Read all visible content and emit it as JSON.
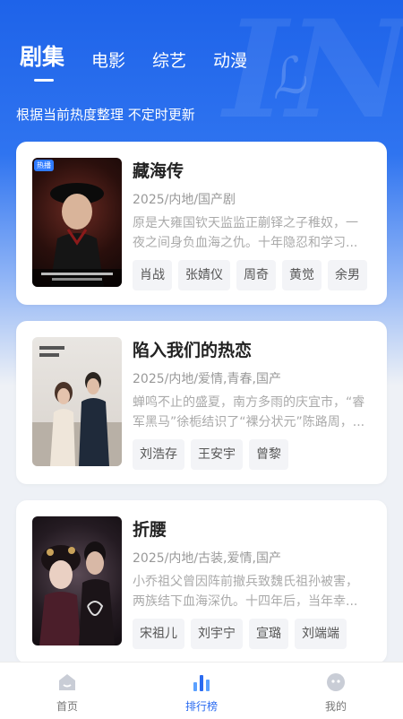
{
  "header": {
    "tabs": [
      {
        "label": "剧集",
        "active": true
      },
      {
        "label": "电影",
        "active": false
      },
      {
        "label": "综艺",
        "active": false
      },
      {
        "label": "动漫",
        "active": false
      }
    ],
    "subtitle": "根据当前热度整理 不定时更新"
  },
  "list": [
    {
      "title": "藏海传",
      "meta": "2025/内地/国产剧",
      "desc": "原是大雍国钦天监监正蒯铎之子稚奴，一夜之间身负血海之仇。十年隐忍和学习...",
      "tags": [
        "肖战",
        "张婧仪",
        "周奇",
        "黄觉",
        "余男"
      ],
      "badge": "热播"
    },
    {
      "title": "陷入我们的热恋",
      "meta": "2025/内地/爱情,青春,国产",
      "desc": "蝉鸣不止的盛夏，南方多雨的庆宜市，“睿军黑马”徐栀结识了“裸分状元”陈路周，...",
      "tags": [
        "刘浩存",
        "王安宇",
        "曾黎"
      ]
    },
    {
      "title": "折腰",
      "meta": "2025/内地/古装,爱情,国产",
      "desc": "小乔祖父曾因阵前撤兵致魏氏祖孙被害，两族结下血海深仇。十四年后，当年幸...",
      "tags": [
        "宋祖儿",
        "刘宇宁",
        "宣璐",
        "刘端端"
      ]
    }
  ],
  "bottom_nav": [
    {
      "label": "首页",
      "icon": "home-icon",
      "active": false
    },
    {
      "label": "排行榜",
      "icon": "ranking-icon",
      "active": true
    },
    {
      "label": "我的",
      "icon": "profile-icon",
      "active": false
    }
  ],
  "colors": {
    "accent": "#2b6bf0",
    "header_top": "#1e63e9"
  }
}
